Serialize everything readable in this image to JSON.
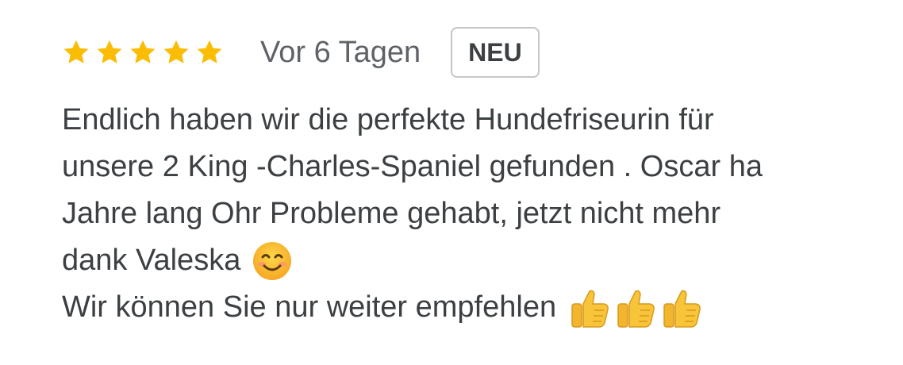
{
  "review": {
    "rating": 5,
    "max_rating": 5,
    "date": "Vor 6 Tagen",
    "badge": "NEU",
    "lines": [
      "Endlich haben wir die perfekte Hundefriseurin für",
      "unsere 2 King -Charles-Spaniel gefunden . Oscar ha",
      "Jahre lang Ohr Probleme gehabt, jetzt nicht mehr",
      "dank Valeska",
      "Wir können Sie nur weiter empfehlen"
    ],
    "emojis": {
      "line_4": "smiling-face-icon",
      "line_5": [
        "thumbs-up-icon",
        "thumbs-up-icon",
        "thumbs-up-icon"
      ]
    }
  },
  "colors": {
    "star": "#fbbc04",
    "text": "#3c4043",
    "date": "#5f6368",
    "badge_border": "#c6c6c6"
  }
}
